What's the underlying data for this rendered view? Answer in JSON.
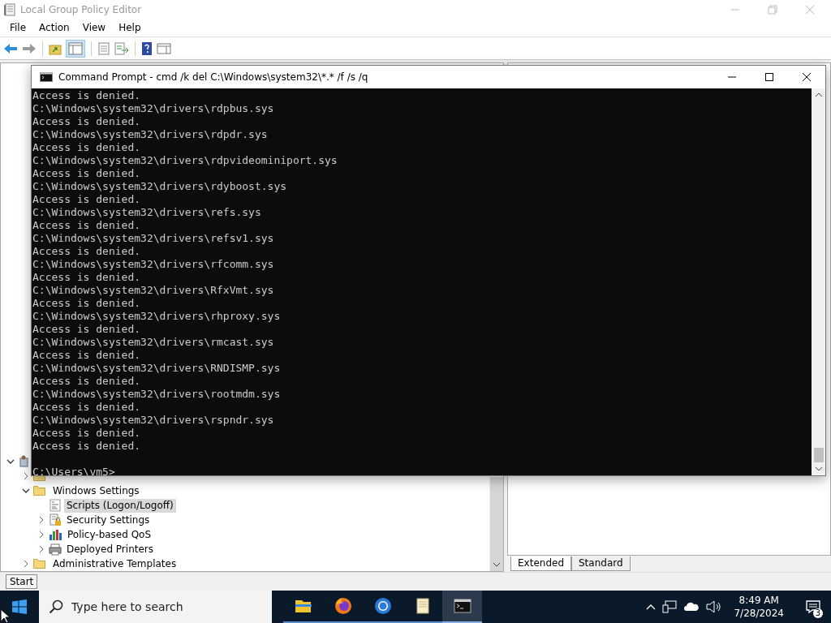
{
  "window": {
    "title": "Local Group Policy Editor"
  },
  "menu": [
    "File",
    "Action",
    "View",
    "Help"
  ],
  "tree": {
    "expanded": true,
    "children": [
      {
        "expanded": false,
        "kind": "folder"
      },
      {
        "label": "Windows Settings",
        "expanded": true,
        "selected": false,
        "kind": "folder",
        "children": [
          {
            "label": "Scripts (Logon/Logoff)",
            "selected": true,
            "kind": "scripts"
          },
          {
            "label": "Security Settings",
            "expanded": false,
            "selected": false,
            "kind": "security"
          },
          {
            "label": "Policy-based QoS",
            "expanded": false,
            "selected": false,
            "kind": "qos"
          },
          {
            "label": "Deployed Printers",
            "expanded": false,
            "selected": false,
            "kind": "printer"
          }
        ]
      },
      {
        "label": "Administrative Templates",
        "expanded": false,
        "selected": false,
        "kind": "folder"
      }
    ]
  },
  "tabs": [
    {
      "label": "Extended",
      "selected": true
    },
    {
      "label": "Standard",
      "selected": false
    }
  ],
  "tooltip": "Start",
  "console": {
    "title": "Command Prompt - cmd  /k del C:\\Windows\\system32\\*.* /f /s /q",
    "lines": [
      "Access is denied.",
      "C:\\Windows\\system32\\drivers\\rdpbus.sys",
      "Access is denied.",
      "C:\\Windows\\system32\\drivers\\rdpdr.sys",
      "Access is denied.",
      "C:\\Windows\\system32\\drivers\\rdpvideominiport.sys",
      "Access is denied.",
      "C:\\Windows\\system32\\drivers\\rdyboost.sys",
      "Access is denied.",
      "C:\\Windows\\system32\\drivers\\refs.sys",
      "Access is denied.",
      "C:\\Windows\\system32\\drivers\\refsv1.sys",
      "Access is denied.",
      "C:\\Windows\\system32\\drivers\\rfcomm.sys",
      "Access is denied.",
      "C:\\Windows\\system32\\drivers\\RfxVmt.sys",
      "Access is denied.",
      "C:\\Windows\\system32\\drivers\\rhproxy.sys",
      "Access is denied.",
      "C:\\Windows\\system32\\drivers\\rmcast.sys",
      "Access is denied.",
      "C:\\Windows\\system32\\drivers\\RNDISMP.sys",
      "Access is denied.",
      "C:\\Windows\\system32\\drivers\\rootmdm.sys",
      "Access is denied.",
      "C:\\Windows\\system32\\drivers\\rspndr.sys",
      "Access is denied.",
      "Access is denied."
    ],
    "prompt": "C:\\Users\\vm5>"
  },
  "taskbar": {
    "search_placeholder": "Type here to search",
    "apps": [
      {
        "kind": "explorer",
        "selected": false
      },
      {
        "kind": "firefox",
        "selected": false
      },
      {
        "kind": "chrome",
        "selected": false
      },
      {
        "kind": "notepad",
        "selected": false
      },
      {
        "kind": "console",
        "selected": true
      }
    ],
    "time": "8:49 AM",
    "date": "7/28/2024",
    "notifications": "3"
  }
}
